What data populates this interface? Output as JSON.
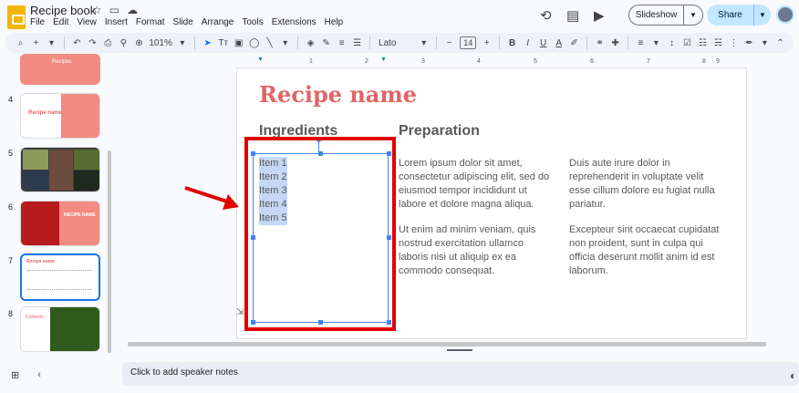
{
  "app": {
    "doc_title": "Recipe book",
    "menus": [
      "File",
      "Edit",
      "View",
      "Insert",
      "Format",
      "Slide",
      "Arrange",
      "Tools",
      "Extensions",
      "Help"
    ],
    "slideshow_label": "Slideshow",
    "share_label": "Share"
  },
  "toolbar": {
    "zoom": "101%",
    "font": "Lato",
    "font_size": "14"
  },
  "filmstrip": {
    "slides": [
      {
        "num": "",
        "title": "Recipes"
      },
      {
        "num": "4",
        "title": "Recipe name"
      },
      {
        "num": "5",
        "title": ""
      },
      {
        "num": "6",
        "title": "RECIPE NAME"
      },
      {
        "num": "7",
        "title": "Recipe name"
      },
      {
        "num": "8",
        "title": "Contents"
      }
    ]
  },
  "ruler": [
    "1",
    "2",
    "3",
    "4",
    "5",
    "6",
    "7",
    "8",
    "9"
  ],
  "slide": {
    "title": "Recipe name",
    "ingredients_heading": "Ingredients",
    "preparation_heading": "Preparation",
    "items": [
      "Item 1",
      "Item 2",
      "Item 3",
      "Item 4",
      "Item 5"
    ],
    "col2_p1": "Lorem ipsum dolor sit amet, consectetur adipiscing elit, sed do eiusmod tempor incididunt ut labore et dolore magna aliqua.",
    "col2_p2": "Ut enim ad minim veniam, quis nostrud exercitation ullamco laboris nisi ut aliquip ex ea commodo consequat.",
    "col3_p1": "Duis aute irure dolor in reprehenderit in voluptate velit esse cillum dolore eu fugiat nulla pariatur.",
    "col3_p2": "Excepteur sint occaecat cupidatat non proident, sunt in culpa qui officia deserunt mollit anim id est laborum."
  },
  "notes": {
    "placeholder": "Click to add speaker notes"
  },
  "colors": {
    "accent_red": "#e06666",
    "selection_blue": "#4285f4",
    "annotation_red": "#e00000"
  }
}
